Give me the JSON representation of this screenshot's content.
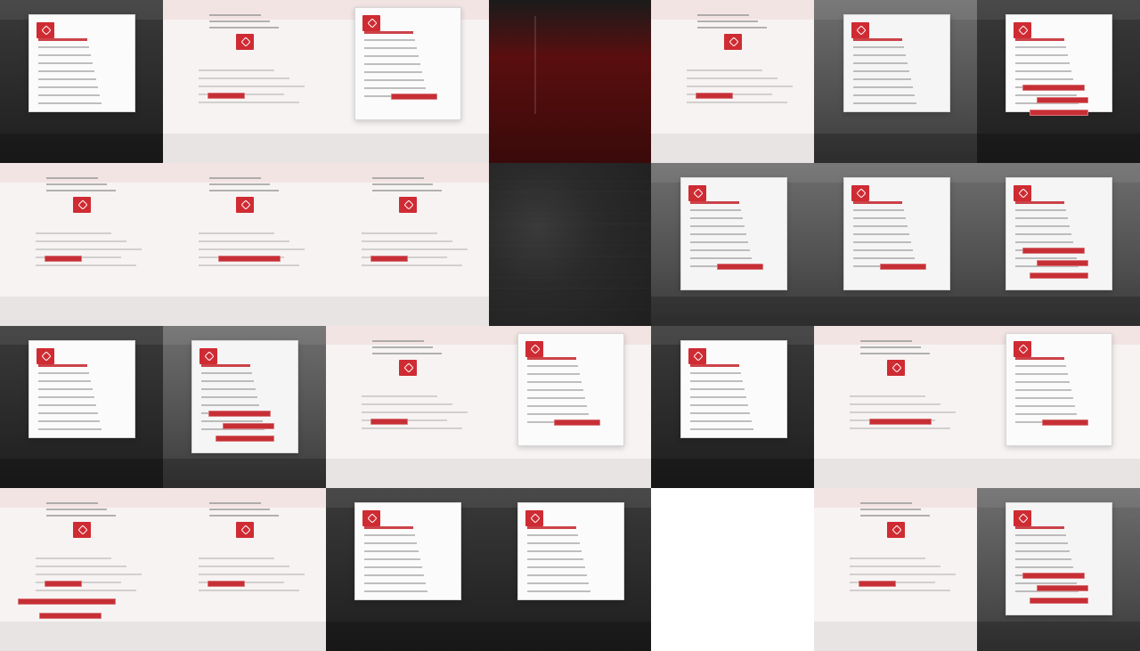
{
  "colors": {
    "dark": "#1b1b1b",
    "dark_alt": "#2c2c2c",
    "light": "#f7f3f3",
    "white": "#ffffff",
    "red": "#c62f35",
    "deep_red": "#5a0e0e",
    "gray": "#6a6a6a"
  },
  "tiles": [
    {
      "id": "t1",
      "style": "dark-card"
    },
    {
      "id": "t2",
      "style": "light-noise"
    },
    {
      "id": "t3",
      "style": "light-doc"
    },
    {
      "id": "t4",
      "style": "deep-red"
    },
    {
      "id": "t5",
      "style": "light-logo"
    },
    {
      "id": "t6",
      "style": "gray-card"
    },
    {
      "id": "t7",
      "style": "dark-card-red-buttons"
    },
    {
      "id": "t8",
      "style": "light-logo"
    },
    {
      "id": "t9",
      "style": "light-logo-wide"
    },
    {
      "id": "t10",
      "style": "light-logo"
    },
    {
      "id": "t11",
      "style": "dark-texture"
    },
    {
      "id": "t12",
      "style": "gray-doc"
    },
    {
      "id": "t13",
      "style": "gray-doc"
    },
    {
      "id": "t14",
      "style": "gray-doc-red"
    },
    {
      "id": "t15",
      "style": "dark-card"
    },
    {
      "id": "t16",
      "style": "gray-doc-red"
    },
    {
      "id": "t17",
      "style": "light-noise"
    },
    {
      "id": "t18",
      "style": "light-doc"
    },
    {
      "id": "t19",
      "style": "dark-card"
    },
    {
      "id": "t20",
      "style": "light-logo-wide"
    },
    {
      "id": "t21",
      "style": "light-doc"
    },
    {
      "id": "t22",
      "style": "light-logo-red-buttons"
    },
    {
      "id": "t23",
      "style": "light-noise"
    },
    {
      "id": "t24",
      "style": "dark-card"
    },
    {
      "id": "t25",
      "style": "dark-card"
    },
    {
      "id": "t26",
      "style": "white-blank"
    },
    {
      "id": "t27",
      "style": "light-logo"
    },
    {
      "id": "t28",
      "style": "gray-doc-red"
    }
  ]
}
